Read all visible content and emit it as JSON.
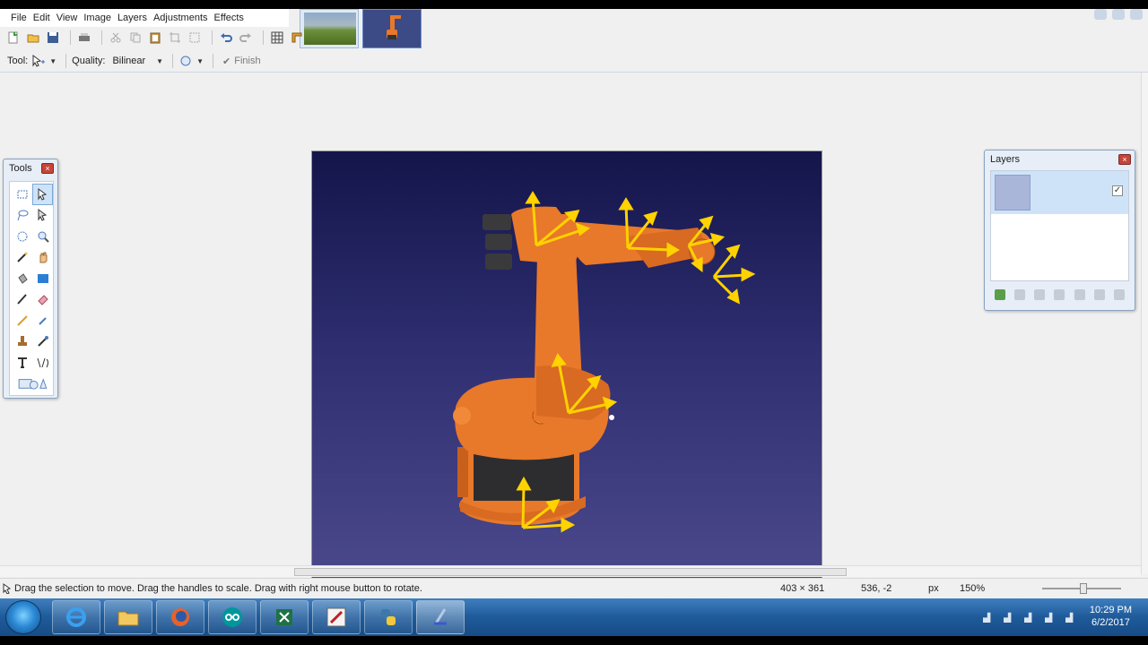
{
  "menu": [
    "File",
    "Edit",
    "View",
    "Image",
    "Layers",
    "Adjustments",
    "Effects"
  ],
  "options": {
    "tool_label": "Tool:",
    "quality_label": "Quality:",
    "quality_value": "Bilinear",
    "finish_label": "Finish"
  },
  "tools_window": {
    "title": "Tools"
  },
  "layers_window": {
    "title": "Layers",
    "layer_visible": true
  },
  "status": {
    "message": "Drag the selection to move. Drag the handles to scale. Drag with right mouse button to rotate.",
    "selection_size": "403 × 361",
    "cursor_position": "536, -2",
    "unit": "px",
    "zoom": "150%"
  },
  "taskbar": {
    "time": "10:29 PM",
    "date": "6/2/2017",
    "apps": [
      "internet-explorer",
      "file-explorer",
      "firefox",
      "arduino",
      "excel",
      "paint-app",
      "python",
      "paint-net"
    ]
  },
  "colors": {
    "canvas_top": "#14154a",
    "canvas_bottom": "#4e4c8e",
    "robot_orange": "#e8782a",
    "arrow_yellow": "#ffd200",
    "taskbar_blue": "#1e5a9a"
  }
}
